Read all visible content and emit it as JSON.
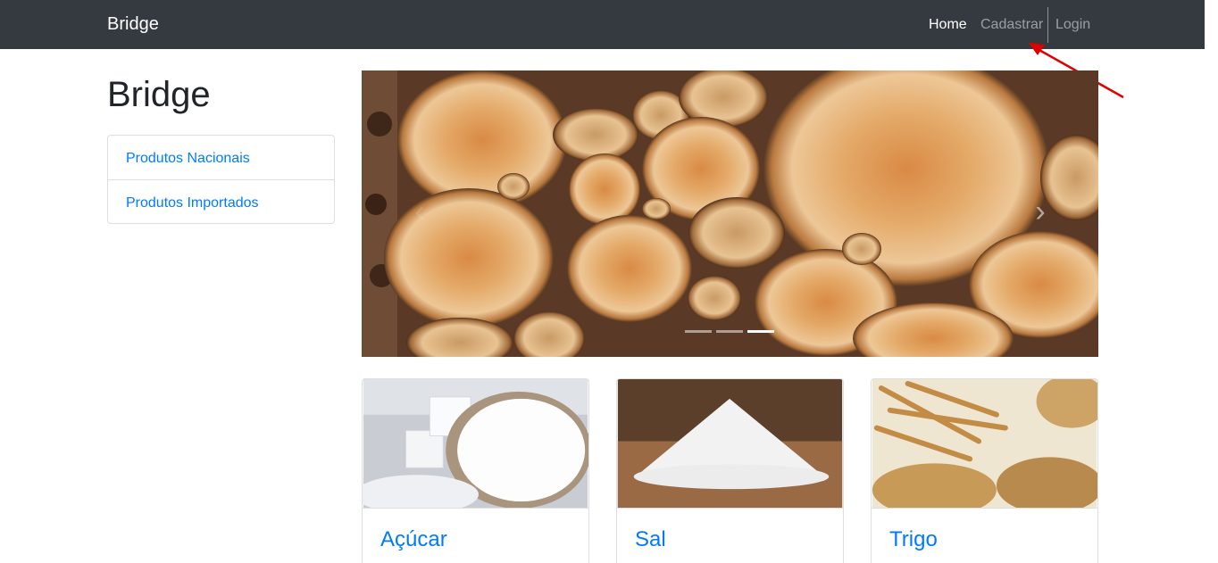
{
  "navbar": {
    "brand": "Bridge",
    "links": [
      {
        "label": "Home",
        "active": true
      },
      {
        "label": "Cadastrar",
        "active": false
      },
      {
        "label": "Login",
        "active": false
      }
    ]
  },
  "sidebar": {
    "title": "Bridge",
    "items": [
      {
        "label": "Produtos Nacionais"
      },
      {
        "label": "Produtos Importados"
      }
    ]
  },
  "carousel": {
    "prev_icon": "chevron-left-icon",
    "next_icon": "chevron-right-icon",
    "slides": 3,
    "active_slide": 3
  },
  "products": [
    {
      "name": "Açúcar"
    },
    {
      "name": "Sal"
    },
    {
      "name": "Trigo"
    }
  ],
  "colors": {
    "navbar": "#343a40",
    "link": "#007bff",
    "annotation_arrow": "#e00000"
  }
}
